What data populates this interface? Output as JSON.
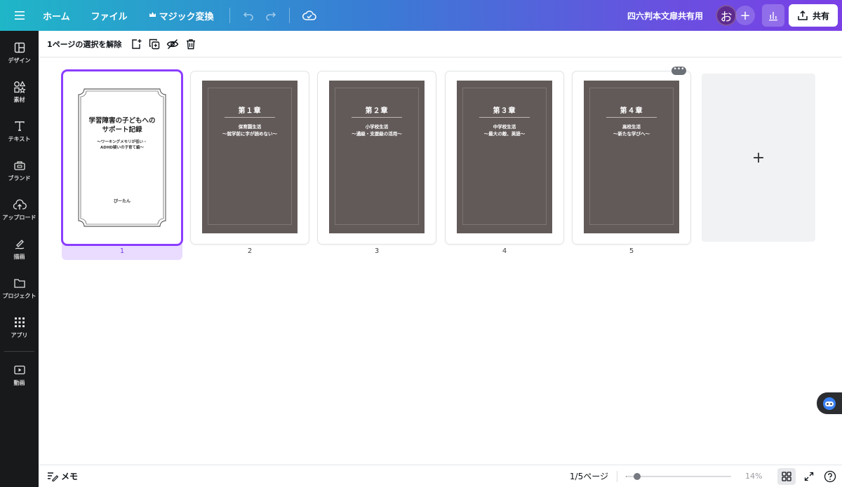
{
  "topbar": {
    "menu_icon": "hamburger-menu-icon",
    "home": "ホーム",
    "file": "ファイル",
    "magic": "マジック変換",
    "magic_icon": "crown-icon",
    "undo_icon": "undo-icon",
    "redo_icon": "redo-icon",
    "cloud_icon": "cloud-saved-icon",
    "doc_title": "四六判本文扉共有用",
    "avatar_initial": "お",
    "add_member": "+",
    "analytics_icon": "bar-chart-icon",
    "share_label": "共有",
    "share_icon": "upload-share-icon"
  },
  "sidebar": {
    "items": [
      {
        "label": "デザイン",
        "icon": "layout-icon"
      },
      {
        "label": "素材",
        "icon": "shapes-icon"
      },
      {
        "label": "テキスト",
        "icon": "text-icon"
      },
      {
        "label": "ブランド",
        "icon": "brand-icon"
      },
      {
        "label": "アップロード",
        "icon": "cloud-upload-icon"
      },
      {
        "label": "描画",
        "icon": "draw-icon"
      },
      {
        "label": "プロジェクト",
        "icon": "folder-icon"
      },
      {
        "label": "アプリ",
        "icon": "apps-grid-icon"
      },
      {
        "label": "動画",
        "icon": "video-icon"
      }
    ]
  },
  "pagebar": {
    "deselect_label": "1ページの選択を解除",
    "icons": [
      "add-page-icon",
      "duplicate-icon",
      "hide-icon",
      "trash-icon"
    ]
  },
  "pages": [
    {
      "number": "1",
      "type": "cover",
      "title_line1": "学習障害の子どもへの",
      "title_line2": "サポート記録",
      "subtitle_line1": "〜ワーキングメモリが低い・",
      "subtitle_line2": "ADHD疑いの子育て編〜",
      "author": "ぴーたん"
    },
    {
      "number": "2",
      "type": "chapter",
      "chapter": "第１章",
      "line1": "保育園生活",
      "line2": "〜就学前に字が読めない〜"
    },
    {
      "number": "3",
      "type": "chapter",
      "chapter": "第２章",
      "line1": "小学校生活",
      "line2": "〜通級・支援級の活用〜"
    },
    {
      "number": "4",
      "type": "chapter",
      "chapter": "第３章",
      "line1": "中学校生活",
      "line2": "〜最大の敵、英語〜"
    },
    {
      "number": "5",
      "type": "chapter",
      "chapter": "第４章",
      "line1": "高校生活",
      "line2": "〜新たな学びへ〜"
    }
  ],
  "more_pill": "•••",
  "add_page_symbol": "+",
  "bottombar": {
    "memo_label": "メモ",
    "memo_icon": "notes-icon",
    "pages_count": "1/5ページ",
    "zoom_label": "14%",
    "zoom_value_percent": 14,
    "grid_icon": "grid-view-icon",
    "fullscreen_icon": "fullscreen-icon",
    "help_icon": "help-icon"
  },
  "colors": {
    "accent": "#8b3dff",
    "chapter_bg": "#625a59",
    "sidebar_bg": "#18191b"
  }
}
